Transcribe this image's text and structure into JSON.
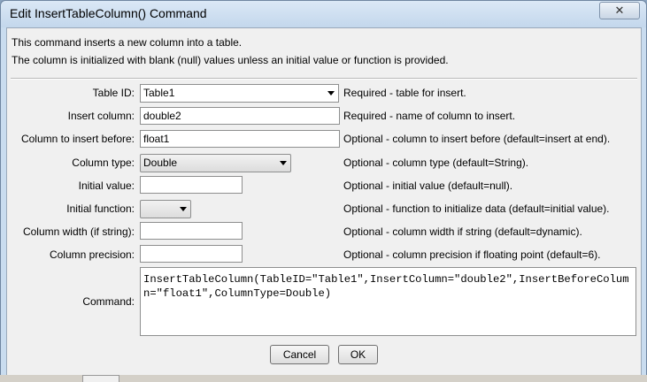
{
  "window": {
    "title": "Edit InsertTableColumn() Command",
    "close_glyph": "✕"
  },
  "description": [
    "This command inserts a new column into a table.",
    "The column is initialized with blank (null) values unless an initial value or function is provided."
  ],
  "fields": {
    "table_id": {
      "label": "Table ID:",
      "value": "Table1",
      "hint": "Required - table for insert."
    },
    "insert_column": {
      "label": "Insert column:",
      "value": "double2",
      "hint": "Required - name of column to insert."
    },
    "insert_before": {
      "label": "Column to insert before:",
      "value": "float1",
      "hint": "Optional - column to insert before (default=insert at end)."
    },
    "column_type": {
      "label": "Column type:",
      "value": "Double",
      "hint": "Optional - column type (default=String)."
    },
    "initial_value": {
      "label": "Initial value:",
      "value": "",
      "hint": "Optional - initial value (default=null)."
    },
    "initial_function": {
      "label": "Initial function:",
      "value": "",
      "hint": "Optional - function to initialize data (default=initial value)."
    },
    "column_width": {
      "label": "Column width (if string):",
      "value": "",
      "hint": "Optional - column width if string (default=dynamic)."
    },
    "column_precision": {
      "label": "Column precision:",
      "value": "",
      "hint": "Optional - column precision if floating point (default=6)."
    }
  },
  "command": {
    "label": "Command:",
    "text": "InsertTableColumn(TableID=\"Table1\",InsertColumn=\"double2\",InsertBeforeColumn=\"float1\",ColumnType=Double)"
  },
  "buttons": {
    "cancel": "Cancel",
    "ok": "OK"
  }
}
